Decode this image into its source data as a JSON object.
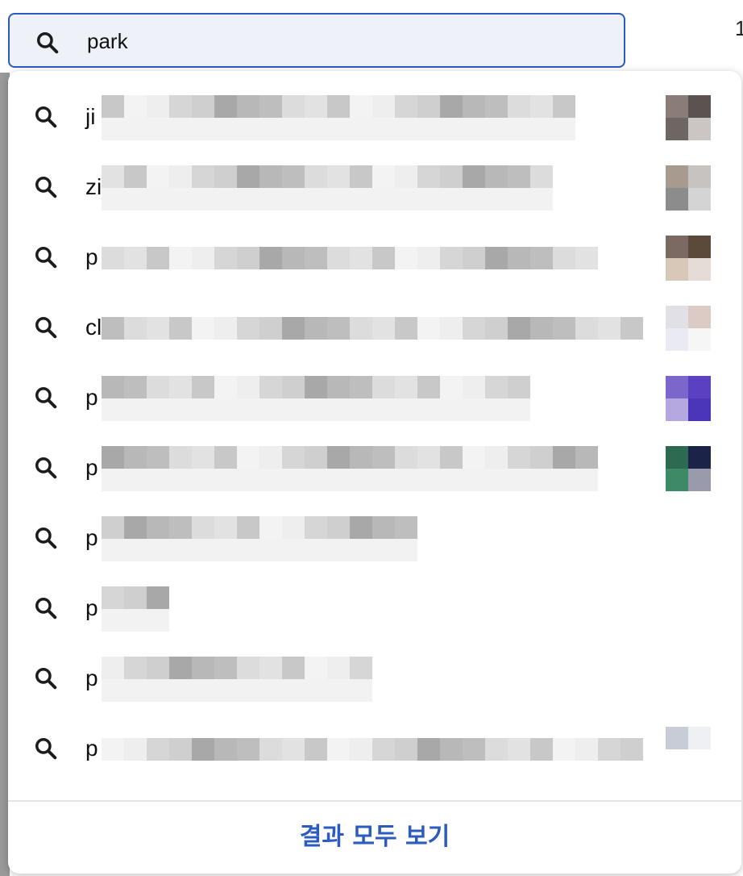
{
  "search": {
    "query": "park"
  },
  "suggestions": [
    {
      "prefix": "ji"
    },
    {
      "prefix": "zi"
    },
    {
      "prefix": "p"
    },
    {
      "prefix": "cl"
    },
    {
      "prefix": "p"
    },
    {
      "prefix": "p"
    },
    {
      "prefix": "p"
    },
    {
      "prefix": "p"
    },
    {
      "prefix": "p"
    },
    {
      "prefix": "p"
    }
  ],
  "see_all_label": "결과 모두 보기",
  "colors": {
    "accent": "#2b5bbe",
    "input_bg": "#eef2f8"
  },
  "icons": {
    "search": "search-icon"
  }
}
